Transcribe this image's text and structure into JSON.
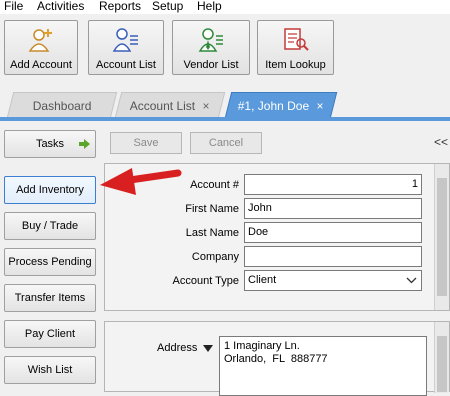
{
  "menu": [
    "File",
    "Activities",
    "Reports",
    "Setup",
    "Help"
  ],
  "toolbar": {
    "add_account": "Add Account",
    "account_list": "Account List",
    "vendor_list": "Vendor List",
    "item_lookup": "Item Lookup"
  },
  "tabs": {
    "dashboard": "Dashboard",
    "account_list": "Account List",
    "account_list_close": "×",
    "current": "#1, John Doe",
    "current_close": "×"
  },
  "left": {
    "tasks": "Tasks",
    "add_inventory": "Add Inventory",
    "buy_trade": "Buy / Trade",
    "process_pending": "Process Pending",
    "transfer_items": "Transfer Items",
    "pay_client": "Pay Client",
    "wish_list": "Wish List"
  },
  "actions": {
    "save": "Save",
    "cancel": "Cancel",
    "collapse": "<<"
  },
  "form": {
    "account_no_label": "Account #",
    "account_no": "1",
    "first_name_label": "First Name",
    "first_name": "John",
    "last_name_label": "Last Name",
    "last_name": "Doe",
    "company_label": "Company",
    "company": "",
    "account_type_label": "Account Type",
    "account_type": "Client"
  },
  "address": {
    "label": "Address",
    "line1": "1 Imaginary Ln.",
    "line2": "Orlando,  FL  888777"
  },
  "colors": {
    "active_tab": "#5a99db",
    "arrow": "#e02020",
    "task_arrow": "#5aa52a"
  }
}
